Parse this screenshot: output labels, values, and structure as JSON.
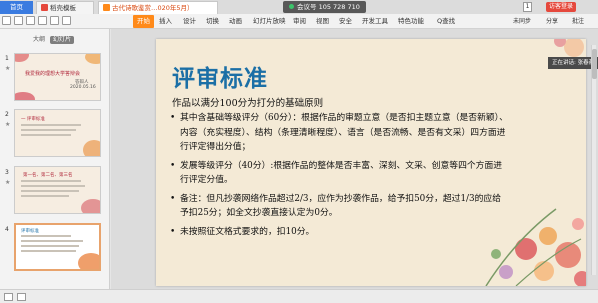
{
  "titlebar": {
    "home_tab": "首页",
    "template_tab": "稻壳模板",
    "document_tab": "古代诗歌鉴赏…020年5月）",
    "meeting": "会议号 105 728 710",
    "window_number": "1",
    "visitor_button": "访客登录"
  },
  "menubar": {
    "items": [
      "开始",
      "插入",
      "设计",
      "切换",
      "动画",
      "幻灯片放映",
      "审阅",
      "视图",
      "安全",
      "开发工具",
      "特色功能"
    ],
    "search": "Q查找",
    "collab": "未同步",
    "share": "分享",
    "comment": "批注"
  },
  "panel": {
    "outline_tab": "大纲",
    "slides_tab": "幻灯片",
    "slide_numbers": [
      "1",
      "2",
      "3",
      "4"
    ],
    "slide1_title": "我爱我的理想大学答辩会",
    "slide1_sub": "答辩人",
    "slide1_date": "2020.05.16",
    "slide2_title": "一 评审标准",
    "slide3_title": "第一名、第二名、第三名",
    "slide4_title": "评审标准"
  },
  "slide": {
    "title": "评审标准",
    "subtitle": "作品以满分100分为打分的基础原则",
    "bullets": [
      "其中含基础等级评分（60分）：根据作品的审题立意（是否扣主题立意（是否新颖）、内容（充实程度）、结构（条理清晰程度）、语言（是否流畅、是否有文采）四方面进行评定得出分值；",
      "发展等级评分（40分）:根据作品的整体是否丰富、深刻、文采、创意等四个方面进行评定分值。",
      "备注：但凡抄袭网络作品超过2/3，应作为抄袭作品，给予扣50分，超过1/3的应给予扣25分；如全文抄袭直接认定为0分。",
      "未按照征文格式要求的，扣10分。"
    ]
  },
  "speaker_label": "正在讲话: 张春燕;",
  "colors": {
    "accent_orange": "#ff8a1a",
    "title_blue": "#1b6fa6",
    "slide_bg": "#f4ead6",
    "visitor_red": "#e5483c",
    "tab_blue": "#3a7be0"
  }
}
